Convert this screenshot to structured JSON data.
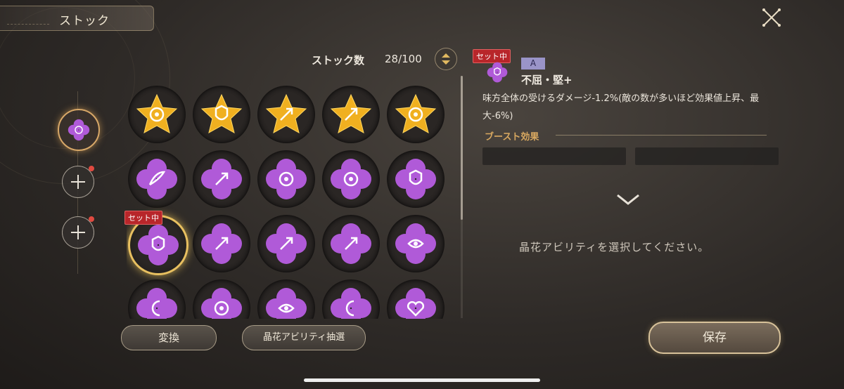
{
  "header": {
    "title": "ストック"
  },
  "stock": {
    "label": "ストック数",
    "count": "28/100"
  },
  "badges": {
    "equipped": "セット中"
  },
  "buttons": {
    "convert": "変換",
    "draw": "晶花アビリティ抽選",
    "save": "保存"
  },
  "selected_ability": {
    "grade": "A",
    "name": "不屈・堅+",
    "description": "味方全体の受けるダメージ-1.2%(敵の数が多いほど効果値上昇、最大-6%)",
    "boost_title": "ブースト効果",
    "prompt": "晶花アビリティを選択してください。"
  },
  "colors": {
    "gold": "#f0b020",
    "purple": "#b05ad8",
    "accent": "#d8a868",
    "badge": "#b8262a"
  },
  "grid_items": [
    {
      "type": "star",
      "icon": "target"
    },
    {
      "type": "star",
      "icon": "shield"
    },
    {
      "type": "star",
      "icon": "arrow"
    },
    {
      "type": "star",
      "icon": "arrow"
    },
    {
      "type": "star",
      "icon": "target"
    },
    {
      "type": "flower",
      "icon": "wing"
    },
    {
      "type": "flower",
      "icon": "arrow"
    },
    {
      "type": "flower",
      "icon": "target"
    },
    {
      "type": "flower",
      "icon": "target"
    },
    {
      "type": "flower",
      "icon": "shield"
    },
    {
      "type": "flower",
      "icon": "shield",
      "equipped": true
    },
    {
      "type": "flower",
      "icon": "arrow"
    },
    {
      "type": "flower",
      "icon": "arrow"
    },
    {
      "type": "flower",
      "icon": "arrow"
    },
    {
      "type": "flower",
      "icon": "eye"
    },
    {
      "type": "flower",
      "icon": "moon"
    },
    {
      "type": "flower",
      "icon": "target"
    },
    {
      "type": "flower",
      "icon": "eye"
    },
    {
      "type": "flower",
      "icon": "moon"
    },
    {
      "type": "flower",
      "icon": "heart"
    }
  ]
}
